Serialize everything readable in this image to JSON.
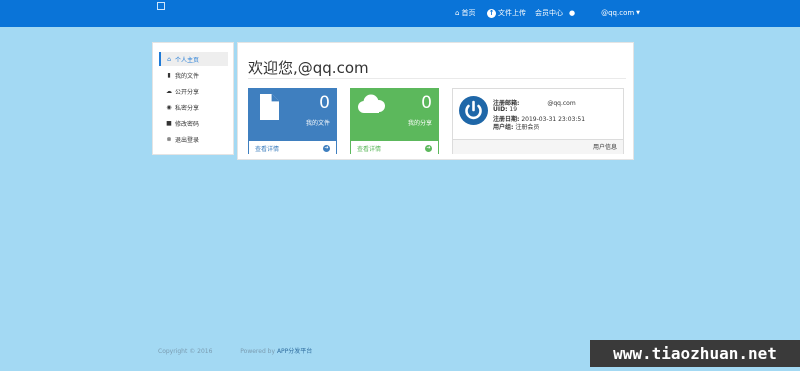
{
  "navbar": {
    "home": "首页",
    "upload": "文件上传",
    "member_center": "会员中心",
    "account": "@qq.com"
  },
  "sidebar": {
    "items": [
      {
        "label": "个人主页",
        "icon": "home-icon",
        "active": true
      },
      {
        "label": "我的文件",
        "icon": "file-icon",
        "active": false
      },
      {
        "label": "公开分享",
        "icon": "cloud-icon",
        "active": false
      },
      {
        "label": "私密分享",
        "icon": "eye-icon",
        "active": false
      },
      {
        "label": "修改密码",
        "icon": "lock-icon",
        "active": false
      },
      {
        "label": "退出登录",
        "icon": "logout-icon",
        "active": false
      }
    ]
  },
  "main": {
    "title": "欢迎您,@qq.com",
    "cards": [
      {
        "count": "0",
        "label": "我的文件",
        "link": "查看详情",
        "color": "#3f7fbf"
      },
      {
        "count": "0",
        "label": "我的分享",
        "link": "查看详情",
        "color": "#5cb85c"
      }
    ],
    "user": {
      "email_label": "注册邮箱:",
      "email_value": "@qq.com",
      "uid_label": "UID:",
      "uid_value": "19",
      "date_label": "注册日期:",
      "date_value": "2019-03-31 23:03:51",
      "group_label": "用户组:",
      "group_value": "注册会员",
      "footer": "用户信息"
    }
  },
  "footer": {
    "copyright": "Copyright © 2016",
    "powered": "Powered by",
    "platform": "APP分发平台"
  },
  "watermark": "www.tiaozhuan.net",
  "colors": {
    "navbar": "#0a74d8",
    "background": "#a3d9f3",
    "accent": "#1f7ad6"
  }
}
